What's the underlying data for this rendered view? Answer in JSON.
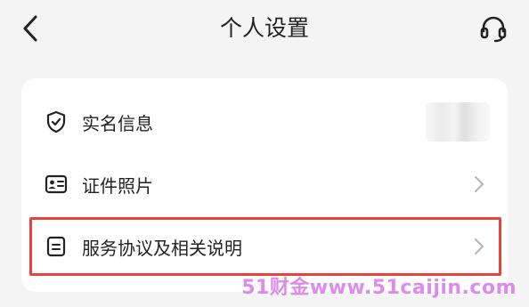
{
  "header": {
    "title": "个人设置"
  },
  "rows": [
    {
      "label": "实名信息",
      "icon": "shield-check-icon"
    },
    {
      "label": "证件照片",
      "icon": "id-card-icon"
    },
    {
      "label": "服务协议及相关说明",
      "icon": "document-icon"
    }
  ],
  "watermark": "51财金www.51caijin.com",
  "colors": {
    "background": "#f4f4f4",
    "card": "#ffffff",
    "text": "#222222",
    "chevron": "#b5b5b5",
    "highlight": "#e8423b",
    "watermark": "#d678e6"
  }
}
